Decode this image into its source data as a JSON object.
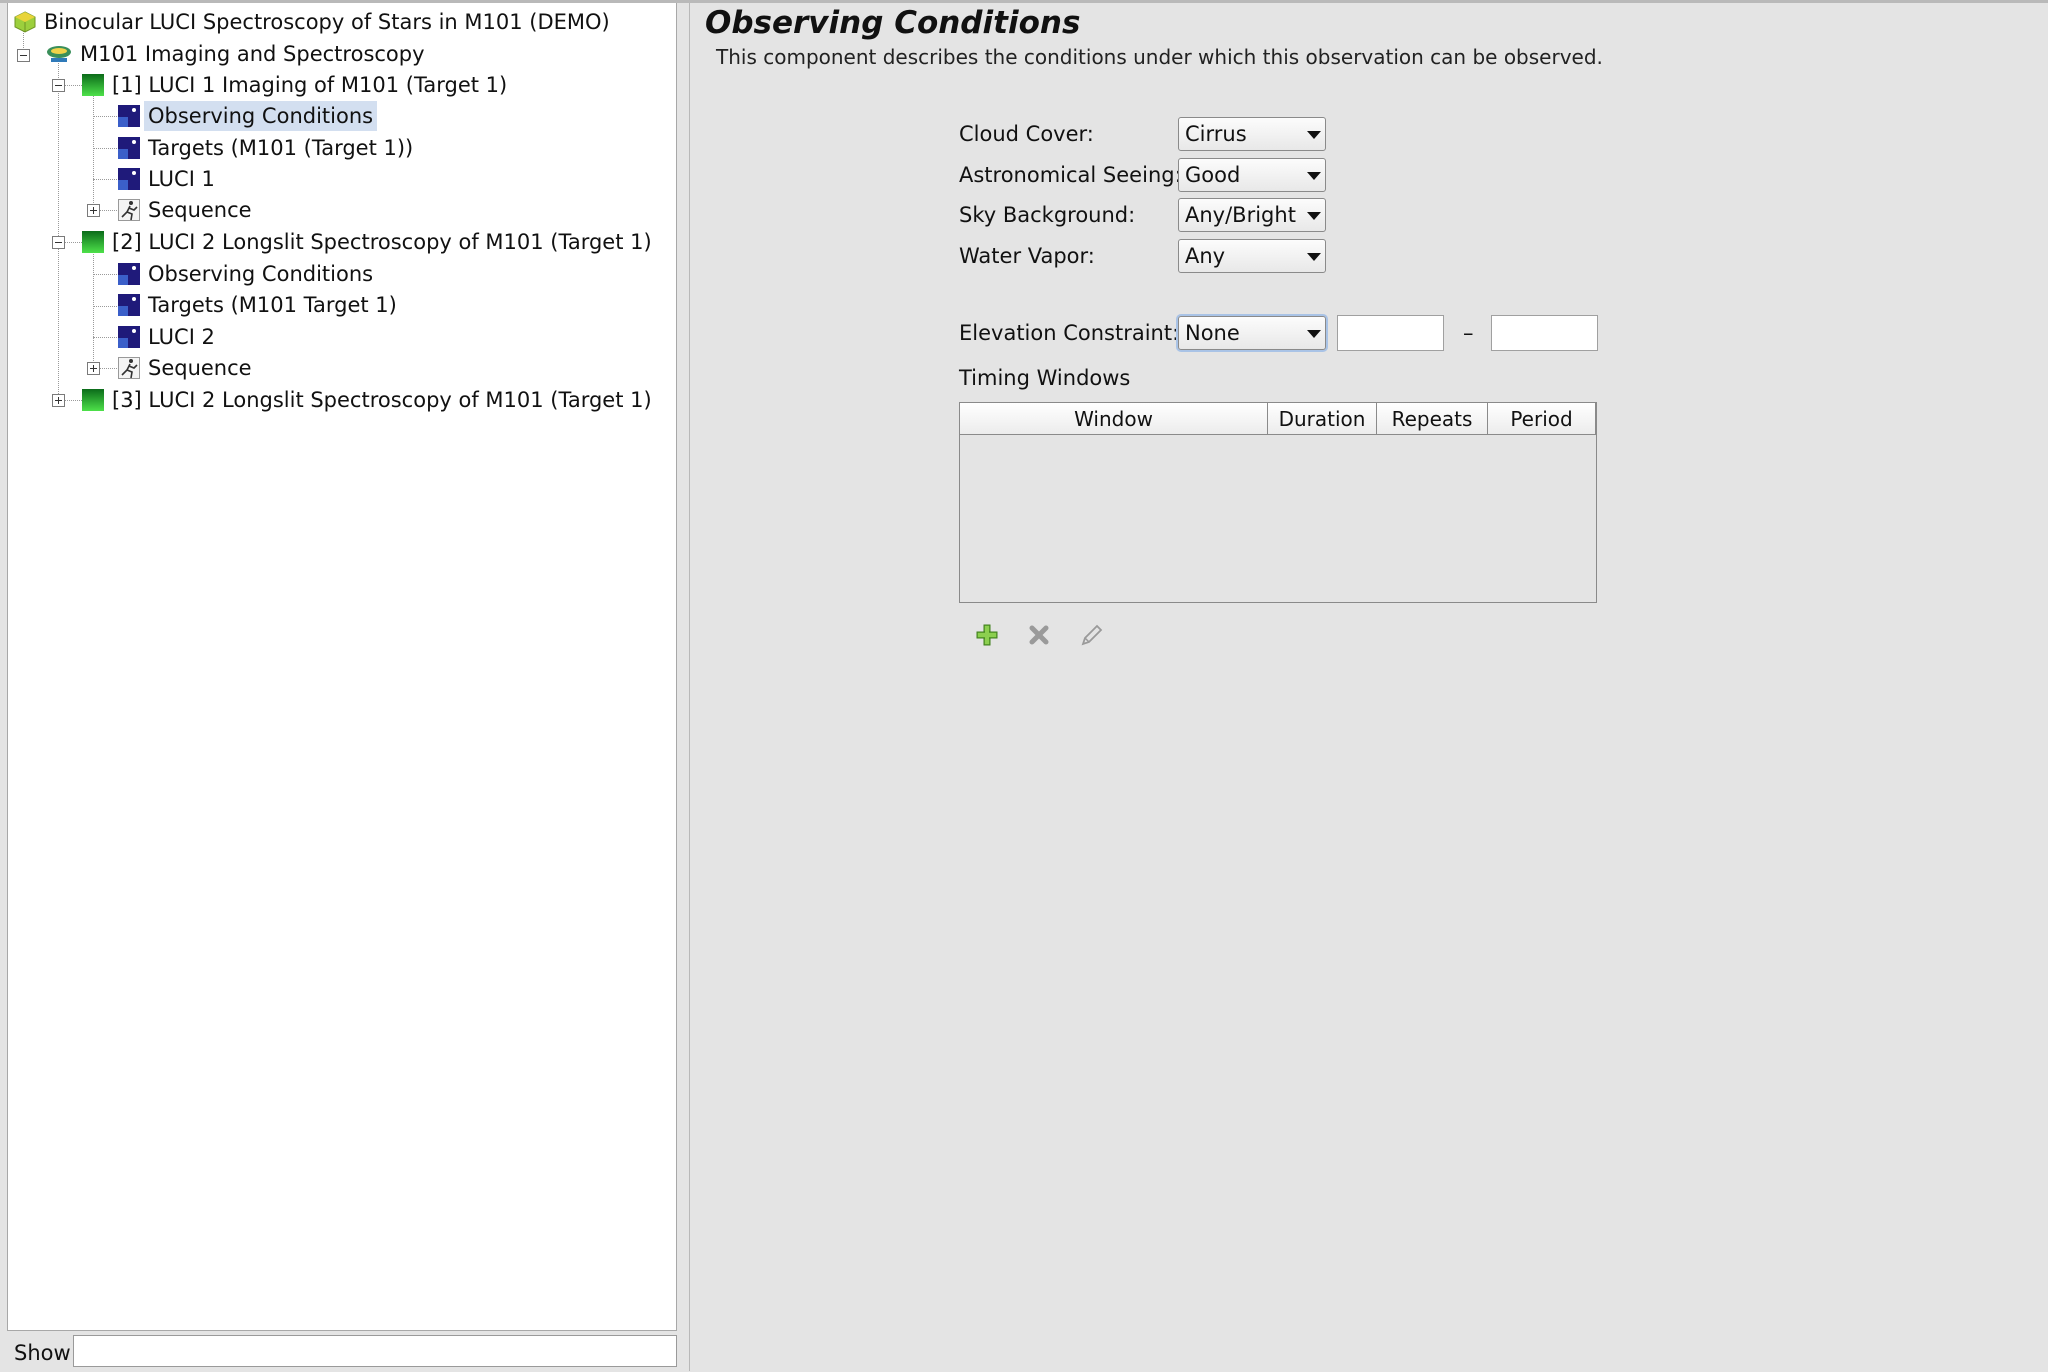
{
  "tree": {
    "root": "Binocular LUCI Spectroscopy of Stars in M101 (DEMO)",
    "program": "M101 Imaging and Spectroscopy",
    "obs1": {
      "label": "[1] LUCI 1 Imaging of M101 (Target 1)",
      "conditions": "Observing Conditions",
      "targets": "Targets (M101 (Target 1))",
      "instrument": "LUCI 1",
      "sequence": "Sequence"
    },
    "obs2": {
      "label": "[2] LUCI 2 Longslit Spectroscopy of M101 (Target 1)",
      "conditions": "Observing Conditions",
      "targets": "Targets (M101 Target 1)",
      "instrument": "LUCI 2",
      "sequence": "Sequence"
    },
    "obs3": {
      "label": "[3] LUCI 2 Longslit Spectroscopy of M101 (Target 1)"
    }
  },
  "show": {
    "label": "Show",
    "value": ""
  },
  "editor": {
    "title": "Observing Conditions",
    "description": "This component describes the conditions under which this observation can be observed.",
    "cloud_cover": {
      "label": "Cloud Cover:",
      "value": "Cirrus"
    },
    "seeing": {
      "label": "Astronomical Seeing:",
      "value": "Good"
    },
    "sky_background": {
      "label": "Sky Background:",
      "value": "Any/Bright"
    },
    "water_vapor": {
      "label": "Water Vapor:",
      "value": "Any"
    },
    "elevation": {
      "label": "Elevation Constraint:",
      "value": "None",
      "min": "",
      "max": "",
      "separator": "–"
    },
    "timing": {
      "label": "Timing Windows",
      "columns": [
        "Window",
        "Duration",
        "Repeats",
        "Period"
      ]
    }
  },
  "icons": {
    "add": "add-icon",
    "remove": "remove-icon",
    "edit": "edit-icon"
  }
}
